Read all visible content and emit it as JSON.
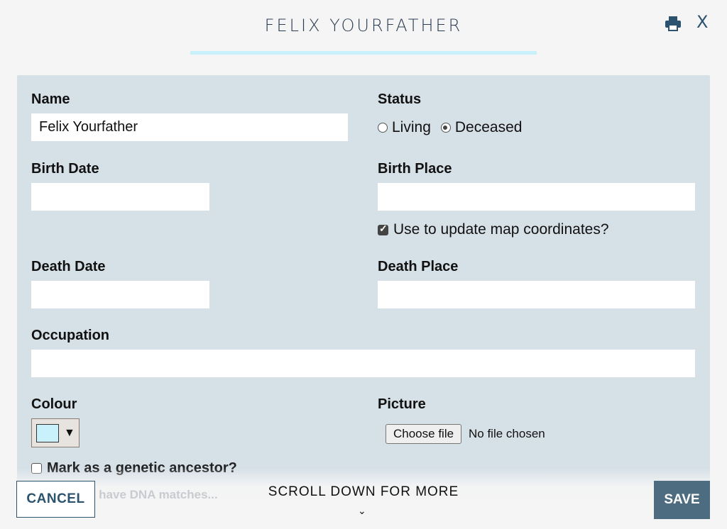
{
  "dialog": {
    "title": "FELIX YOURFATHER",
    "close_label": "X",
    "print_icon": "print-icon"
  },
  "form": {
    "name": {
      "label": "Name",
      "value": "Felix Yourfather"
    },
    "status": {
      "label": "Status",
      "options": [
        "Living",
        "Deceased"
      ],
      "selected": "Deceased"
    },
    "birth_date": {
      "label": "Birth Date",
      "value": ""
    },
    "birth_place": {
      "label": "Birth Place",
      "value": ""
    },
    "update_map": {
      "label": "Use to update map coordinates?",
      "checked": true
    },
    "death_date": {
      "label": "Death Date",
      "value": ""
    },
    "death_place": {
      "label": "Death Place",
      "value": ""
    },
    "occupation": {
      "label": "Occupation",
      "value": ""
    },
    "colour": {
      "label": "Colour",
      "value": "#c9f1fb",
      "caret": "▼"
    },
    "picture": {
      "label": "Picture",
      "button": "Choose file",
      "status": "No file chosen"
    },
    "genetic_ancestor": {
      "label": "Mark as a genetic ancestor?",
      "checked": false
    },
    "genetic_hint": "...box if you have DNA matches..."
  },
  "footer": {
    "cancel": "CANCEL",
    "scroll_more": "SCROLL DOWN FOR MORE",
    "scroll_chevron": "⌄",
    "save": "SAVE"
  },
  "colors": {
    "accent": "#2b5370",
    "panel": "#d6e0e7",
    "save_bg": "#4d6c80",
    "underline": "#c9f1fb"
  }
}
